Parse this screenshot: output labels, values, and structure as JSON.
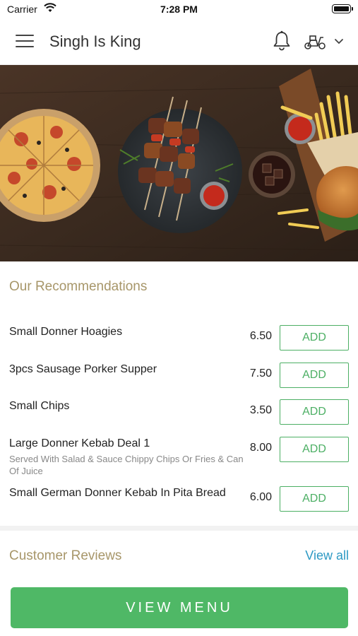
{
  "status_bar": {
    "carrier": "Carrier",
    "time": "7:28 PM"
  },
  "header": {
    "title": "Singh Is King",
    "icons": [
      "menu-icon",
      "bell-icon",
      "scooter-icon",
      "chevron-down-icon"
    ]
  },
  "hero": {
    "description": "food banner"
  },
  "recommendations": {
    "title": "Our Recommendations",
    "items": [
      {
        "name": "Small Donner Hoagies",
        "description": "",
        "price": "6.50",
        "action": "ADD"
      },
      {
        "name": "3pcs Sausage Porker Supper",
        "description": "",
        "price": "7.50",
        "action": "ADD"
      },
      {
        "name": "Small Chips",
        "description": "",
        "price": "3.50",
        "action": "ADD"
      },
      {
        "name": "Large Donner Kebab Deal 1",
        "description": "Served With Salad & Sauce Chippy Chips Or Fries & Can Of Juice",
        "price": "8.00",
        "action": "ADD"
      },
      {
        "name": "Small German Donner Kebab In Pita Bread",
        "description": "",
        "price": "6.00",
        "action": "ADD"
      }
    ]
  },
  "reviews": {
    "title": "Customer Reviews",
    "view_all": "View all"
  },
  "footer": {
    "view_menu": "VIEW MENU"
  },
  "colors": {
    "accent_green": "#4caf64",
    "section_title": "#a79669",
    "link_blue": "#2e9ac4"
  }
}
